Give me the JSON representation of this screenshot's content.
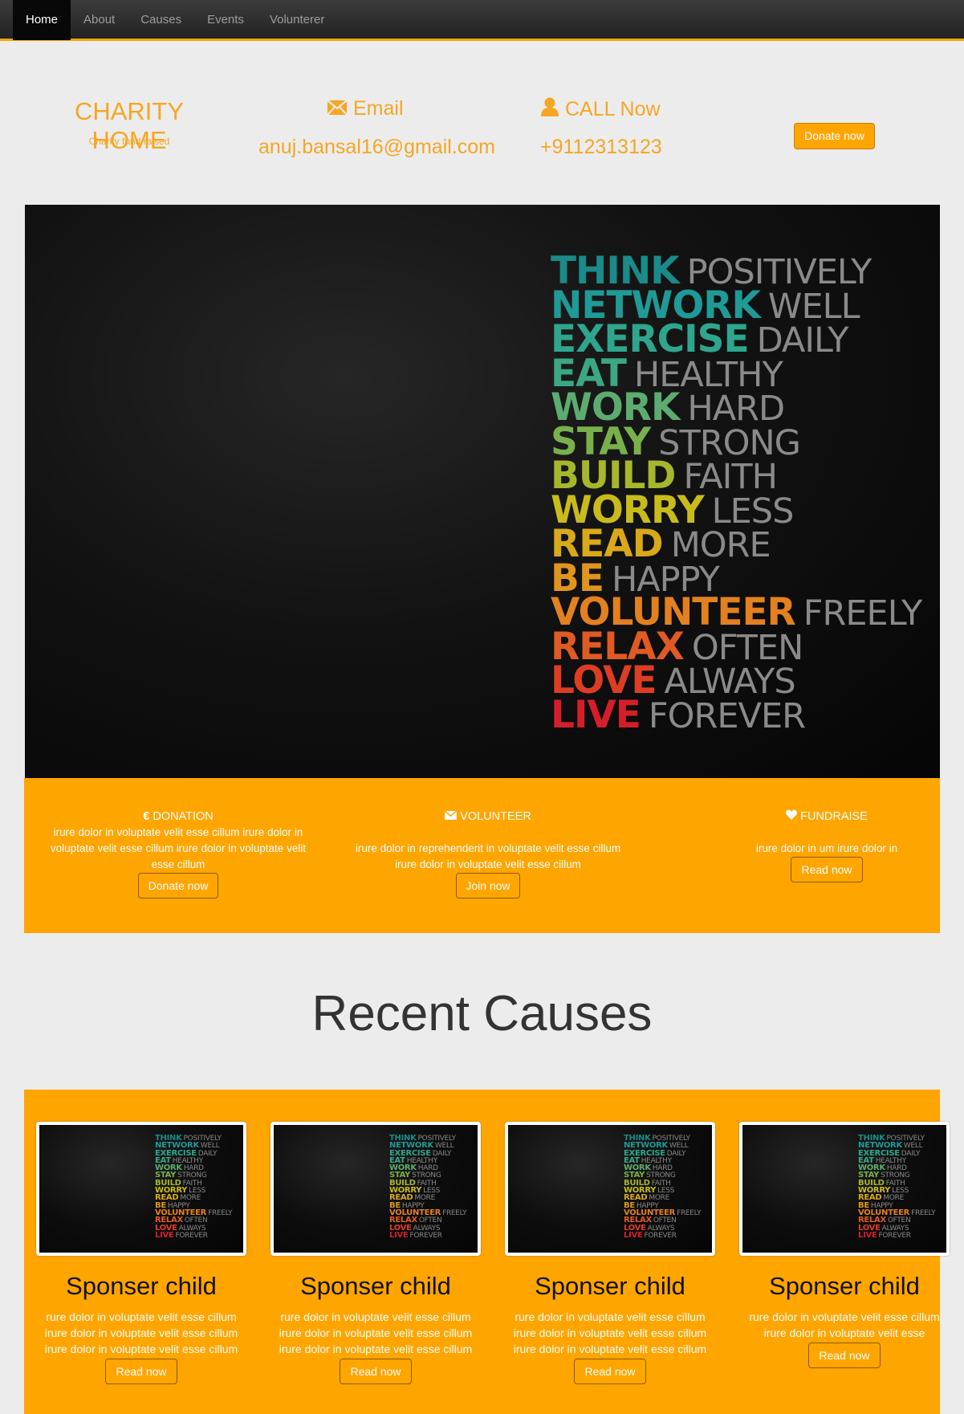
{
  "nav": {
    "items": [
      {
        "label": "Home",
        "active": true
      },
      {
        "label": "About",
        "active": false
      },
      {
        "label": "Causes",
        "active": false
      },
      {
        "label": "Events",
        "active": false
      },
      {
        "label": "Volunterer",
        "active": false
      }
    ]
  },
  "header": {
    "brand_title": "CHARITY HOME",
    "brand_subtitle": "Charity fund raised",
    "email_label": "Email",
    "email_value": "anuj.bansal16@gmail.com",
    "call_label": "CALL Now",
    "call_value": "+9112313123",
    "donate_button": "Donate now"
  },
  "hero": {
    "lines": [
      {
        "bold": "THINK",
        "light": "POSITIVELY",
        "color": "#1a8a8a"
      },
      {
        "bold": "NETWORK",
        "light": "WELL",
        "color": "#1f9a97"
      },
      {
        "bold": "EXERCISE",
        "light": "DAILY",
        "color": "#2ea68e"
      },
      {
        "bold": "EAT",
        "light": "HEALTHY",
        "color": "#3aa883"
      },
      {
        "bold": "WORK",
        "light": "HARD",
        "color": "#5cac70"
      },
      {
        "bold": "STAY",
        "light": "STRONG",
        "color": "#7ab04c"
      },
      {
        "bold": "BUILD",
        "light": "FAITH",
        "color": "#a6b72c"
      },
      {
        "bold": "WORRY",
        "light": "LESS",
        "color": "#c9bb1c"
      },
      {
        "bold": "READ",
        "light": "MORE",
        "color": "#d9a91a"
      },
      {
        "bold": "BE",
        "light": "HAPPY",
        "color": "#e0951c"
      },
      {
        "bold": "VOLUNTEER",
        "light": "FREELY",
        "color": "#e3801f"
      },
      {
        "bold": "RELAX",
        "light": "OFTEN",
        "color": "#e05a23"
      },
      {
        "bold": "LOVE",
        "light": "ALWAYS",
        "color": "#de3d24"
      },
      {
        "bold": "LIVE",
        "light": "FOREVER",
        "color": "#d41f2a"
      }
    ]
  },
  "features": [
    {
      "icon": "euro-icon",
      "title": "DONATION",
      "text": "irure dolor in voluptate velit esse cillum irure dolor in voluptate velit esse cillum irure dolor in voluptate velit esse cillum",
      "button": "Donate now"
    },
    {
      "icon": "envelope-icon",
      "title": "VOLUNTEER",
      "text": "irure dolor in reprehenderit in voluptate velit esse cillum irure dolor in voluptate velit esse cillum",
      "button": "Join now"
    },
    {
      "icon": "heart-icon",
      "title": "FUNDRAISE",
      "text": "irure dolor in um irure dolor in",
      "button": "Read now"
    }
  ],
  "recent": {
    "title": "Recent Causes",
    "cards": [
      {
        "title": "Sponser child",
        "text": "rure dolor in voluptate velit esse cillum irure dolor in voluptate velit esse cillum irure dolor in voluptate velit esse cillum",
        "button": "Read now"
      },
      {
        "title": "Sponser child",
        "text": "rure dolor in voluptate velit esse cillum irure dolor in voluptate velit esse cillum irure dolor in voluptate velit esse cillum",
        "button": "Read now"
      },
      {
        "title": "Sponser child",
        "text": "rure dolor in voluptate velit esse cillum irure dolor in voluptate velit esse cillum irure dolor in voluptate velit esse cillum",
        "button": "Read now"
      },
      {
        "title": "Sponser child",
        "text": "rure dolor in voluptate velit esse cillum irure dolor in voluptate velit esse",
        "button": "Read now"
      }
    ]
  },
  "colors": {
    "accent": "#ffa500",
    "brand_text": "#f5a623",
    "nav_bg": "#222222"
  }
}
